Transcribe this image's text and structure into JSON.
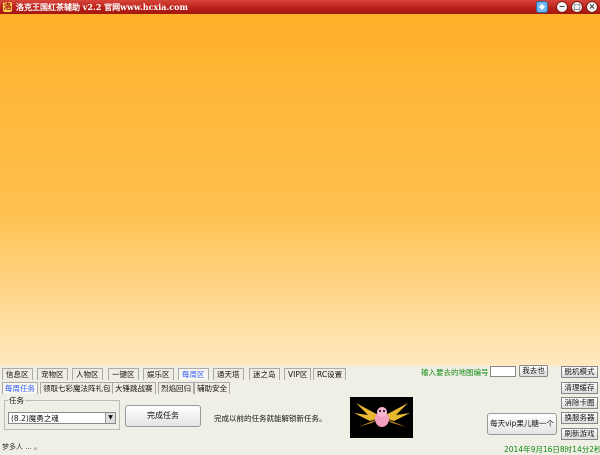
{
  "window": {
    "title": "洛克王国红茶辅助 v2.2 官网www.hcxia.com",
    "icon": "app-icon",
    "controls": {
      "skin": "skin-icon",
      "minimize": "−",
      "maximize": "□",
      "close": "×"
    }
  },
  "colors": {
    "titlebar": "#b51f18",
    "game_top": "#ffb02a",
    "game_bottom": "#ffe9c0",
    "active_tab": "#2f5bff",
    "time_text": "#118811"
  },
  "tabs": [
    {
      "label": "信息区",
      "active": false
    },
    {
      "label": "宠物区",
      "active": false
    },
    {
      "label": "人物区",
      "active": false
    },
    {
      "label": "一键区",
      "active": false
    },
    {
      "label": "娱乐区",
      "active": false
    },
    {
      "label": "每周区",
      "active": true
    },
    {
      "label": "通天塔",
      "active": false
    },
    {
      "label": "迷之岛",
      "active": false
    },
    {
      "label": "VIP区",
      "active": false
    },
    {
      "label": "RC设置",
      "active": false
    }
  ],
  "map": {
    "label": "输入要去的地图编号",
    "value": "",
    "go_label": "我去也"
  },
  "subtabs": [
    {
      "label": "每周任务",
      "active": true
    },
    {
      "label": "领取七彩魔法阵礼包",
      "active": false
    },
    {
      "label": "大锤跳战赛",
      "active": false
    },
    {
      "label": "烈焰回归",
      "active": false
    },
    {
      "label": "辅助安全",
      "active": false
    }
  ],
  "task": {
    "group_label": "任务",
    "selected": "(8.2)魔勇之魂",
    "complete_label": "完成任务",
    "info": "完成以前的任务就能解锁新任务。"
  },
  "vip_button": "每天vip果儿糖一个",
  "side_buttons": [
    "脱机模式",
    "清理缓存",
    "消除卡圈",
    "换服务器",
    "刷新游戏"
  ],
  "status": {
    "left": "梦多人 ... 。",
    "time": "2014年9月16日8时14分2秒"
  }
}
